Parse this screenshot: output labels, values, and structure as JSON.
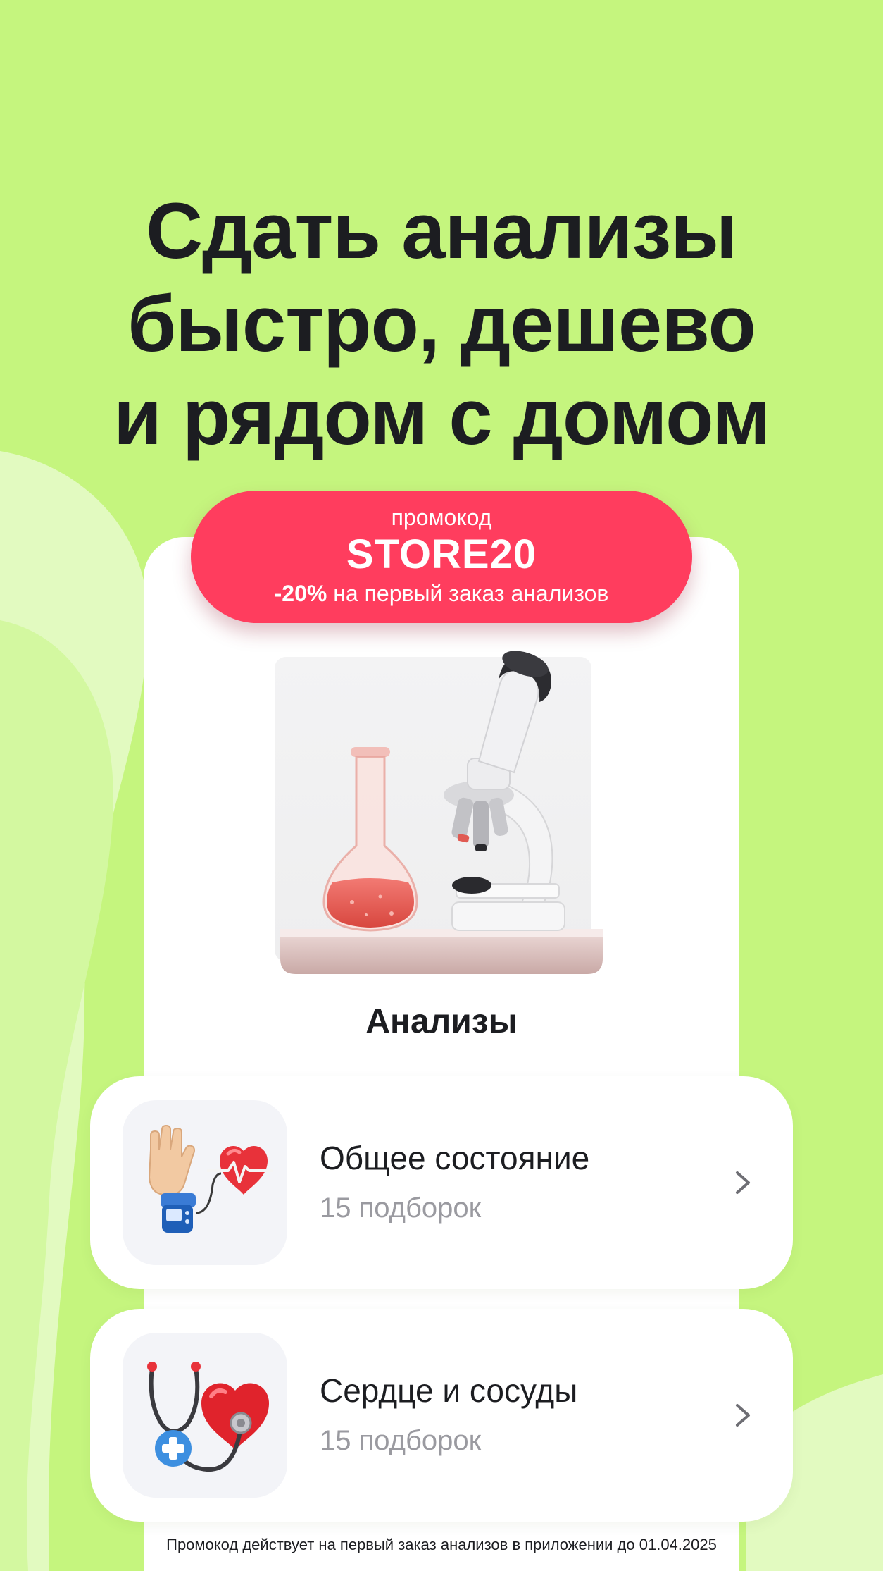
{
  "headline": {
    "line1": "Сдать анализы",
    "line2": "быстро, дешево",
    "line3": "и рядом с домом"
  },
  "promo": {
    "label": "промокод",
    "code": "STORE20",
    "discount": "-20%",
    "description": "на первый заказ анализов"
  },
  "section": {
    "title": "Анализы",
    "image_icon": "lab-flask-microscope-icon"
  },
  "categories": [
    {
      "title": "Общее состояние",
      "subtitle": "15 подборок",
      "icon": "hand-heart-monitor-icon"
    },
    {
      "title": "Сердце и сосуды",
      "subtitle": "15 подборок",
      "icon": "stethoscope-heart-icon"
    }
  ],
  "footnote": "Промокод действует на первый заказ анализов в приложении до 01.04.2025",
  "colors": {
    "background": "#c5f57e",
    "promo": "#ff3d5e",
    "panel": "#ffffff",
    "text": "#1c1d21",
    "muted": "#9a9aa0"
  }
}
